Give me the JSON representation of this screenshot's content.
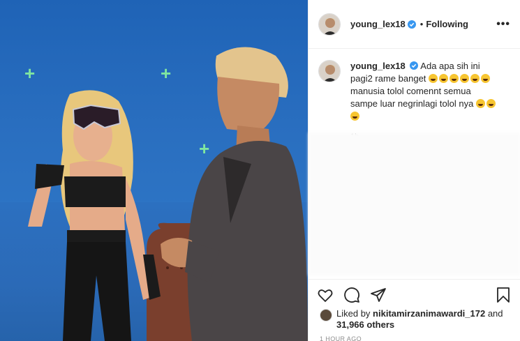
{
  "post": {
    "username": "young_lex18",
    "follow_status": "Following",
    "more_label": "•••",
    "separator": "•"
  },
  "caption": {
    "username": "young_lex18",
    "line1": "Ada apa sih ini pagi2 rame banget",
    "line2": "manusia tolol comennt semua sampe luar negrinlagi tolol nya",
    "emoji_count_1": 6,
    "emoji_count_2": 3,
    "time": "1h"
  },
  "likes": {
    "prefix": "Liked by",
    "user": "nikitamirzanimawardi_172",
    "conjunction": "and",
    "count": "31,966 others"
  },
  "post_time": "1 HOUR AGO",
  "colors": {
    "verified": "#3897f0",
    "backdrop": "#2a6fc0",
    "tracker": "#7fe6a0"
  },
  "icons": [
    "like-icon",
    "comment-icon",
    "share-icon",
    "save-icon",
    "verified-badge-icon"
  ]
}
